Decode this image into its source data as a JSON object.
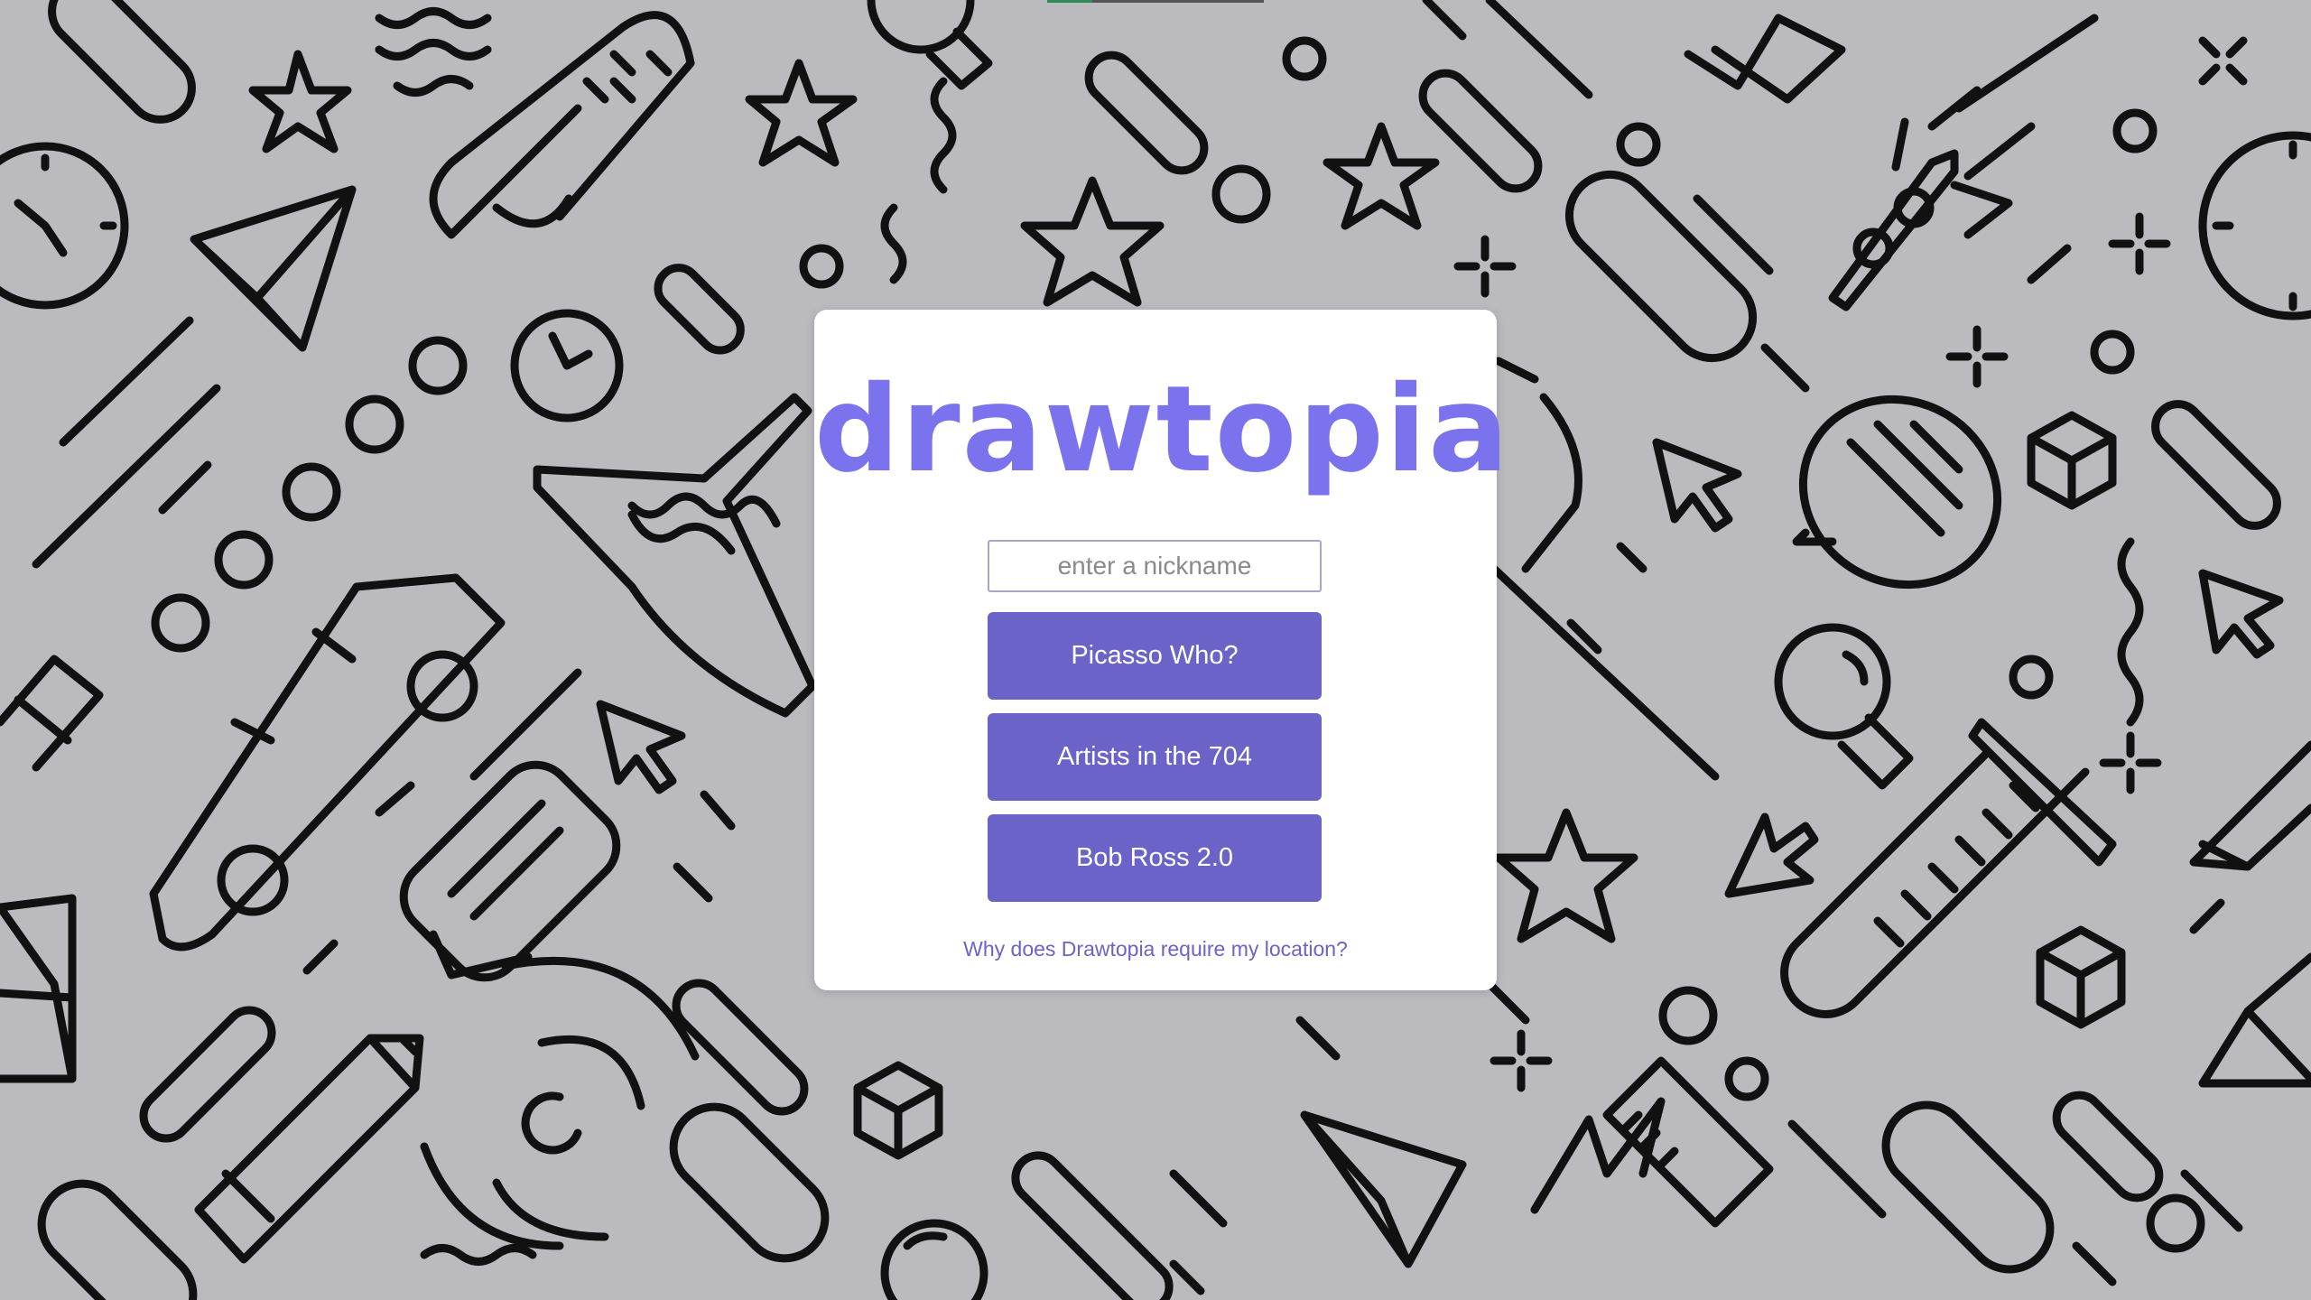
{
  "app": {
    "logo_text": "drawtopia",
    "brand_color": "#7b72ee",
    "button_color": "#6c63c8",
    "background_color": "#bbbbbf"
  },
  "login": {
    "nickname_placeholder": "enter a nickname",
    "nickname_value": "",
    "rooms": [
      {
        "label": "Picasso Who?"
      },
      {
        "label": "Artists in the 704"
      },
      {
        "label": "Bob Ross 2.0"
      }
    ],
    "location_link": "Why does Drawtopia require my location?"
  }
}
